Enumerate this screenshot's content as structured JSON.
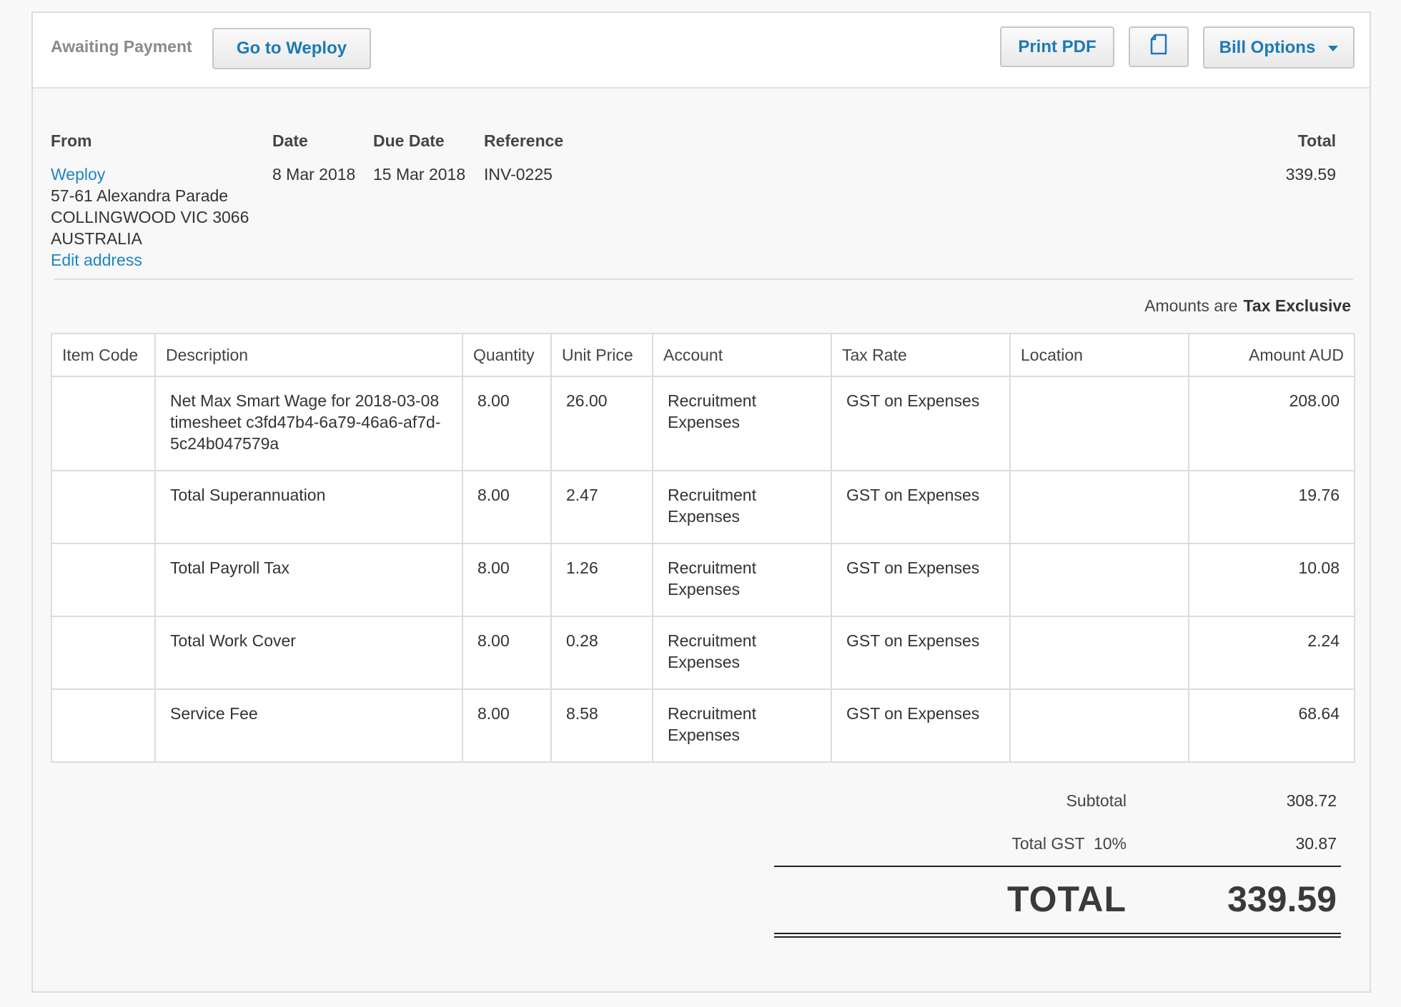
{
  "toolbar": {
    "status": "Awaiting Payment",
    "go_to_label": "Go to Weploy",
    "print_pdf_label": "Print PDF",
    "copy_icon": "document-copy-icon",
    "bill_options_label": "Bill Options"
  },
  "header": {
    "from_label": "From",
    "date_label": "Date",
    "due_date_label": "Due Date",
    "reference_label": "Reference",
    "total_label": "Total",
    "from_name": "Weploy",
    "address_lines": [
      "57-61 Alexandra Parade",
      "COLLINGWOOD VIC 3066",
      "AUSTRALIA"
    ],
    "edit_address": "Edit address",
    "date": "8 Mar 2018",
    "due_date": "15 Mar 2018",
    "reference": "INV-0225",
    "total": "339.59"
  },
  "tax_note": {
    "prefix": "Amounts are",
    "mode": "Tax Exclusive"
  },
  "table": {
    "columns": [
      "Item Code",
      "Description",
      "Quantity",
      "Unit Price",
      "Account",
      "Tax Rate",
      "Location",
      "Amount AUD"
    ],
    "rows": [
      {
        "item_code": "",
        "description": "Net Max Smart Wage for 2018-03-08 timesheet c3fd47b4-6a79-46a6-af7d-5c24b047579a",
        "quantity": "8.00",
        "unit_price": "26.00",
        "account": "Recruitment Expenses",
        "tax_rate": "GST on Expenses",
        "location": "",
        "amount": "208.00"
      },
      {
        "item_code": "",
        "description": "Total Superannuation",
        "quantity": "8.00",
        "unit_price": "2.47",
        "account": "Recruitment Expenses",
        "tax_rate": "GST on Expenses",
        "location": "",
        "amount": "19.76"
      },
      {
        "item_code": "",
        "description": "Total Payroll Tax",
        "quantity": "8.00",
        "unit_price": "1.26",
        "account": "Recruitment Expenses",
        "tax_rate": "GST on Expenses",
        "location": "",
        "amount": "10.08"
      },
      {
        "item_code": "",
        "description": "Total Work Cover",
        "quantity": "8.00",
        "unit_price": "0.28",
        "account": "Recruitment Expenses",
        "tax_rate": "GST on Expenses",
        "location": "",
        "amount": "2.24"
      },
      {
        "item_code": "",
        "description": "Service Fee",
        "quantity": "8.00",
        "unit_price": "8.58",
        "account": "Recruitment Expenses",
        "tax_rate": "GST on Expenses",
        "location": "",
        "amount": "68.64"
      }
    ]
  },
  "totals": {
    "subtotal_label": "Subtotal",
    "subtotal": "308.72",
    "gst_label": "Total GST  10%",
    "gst": "30.87",
    "grand_label": "TOTAL",
    "grand": "339.59"
  },
  "colors": {
    "link": "#1c86c3",
    "button_text": "#1c7ab8"
  }
}
